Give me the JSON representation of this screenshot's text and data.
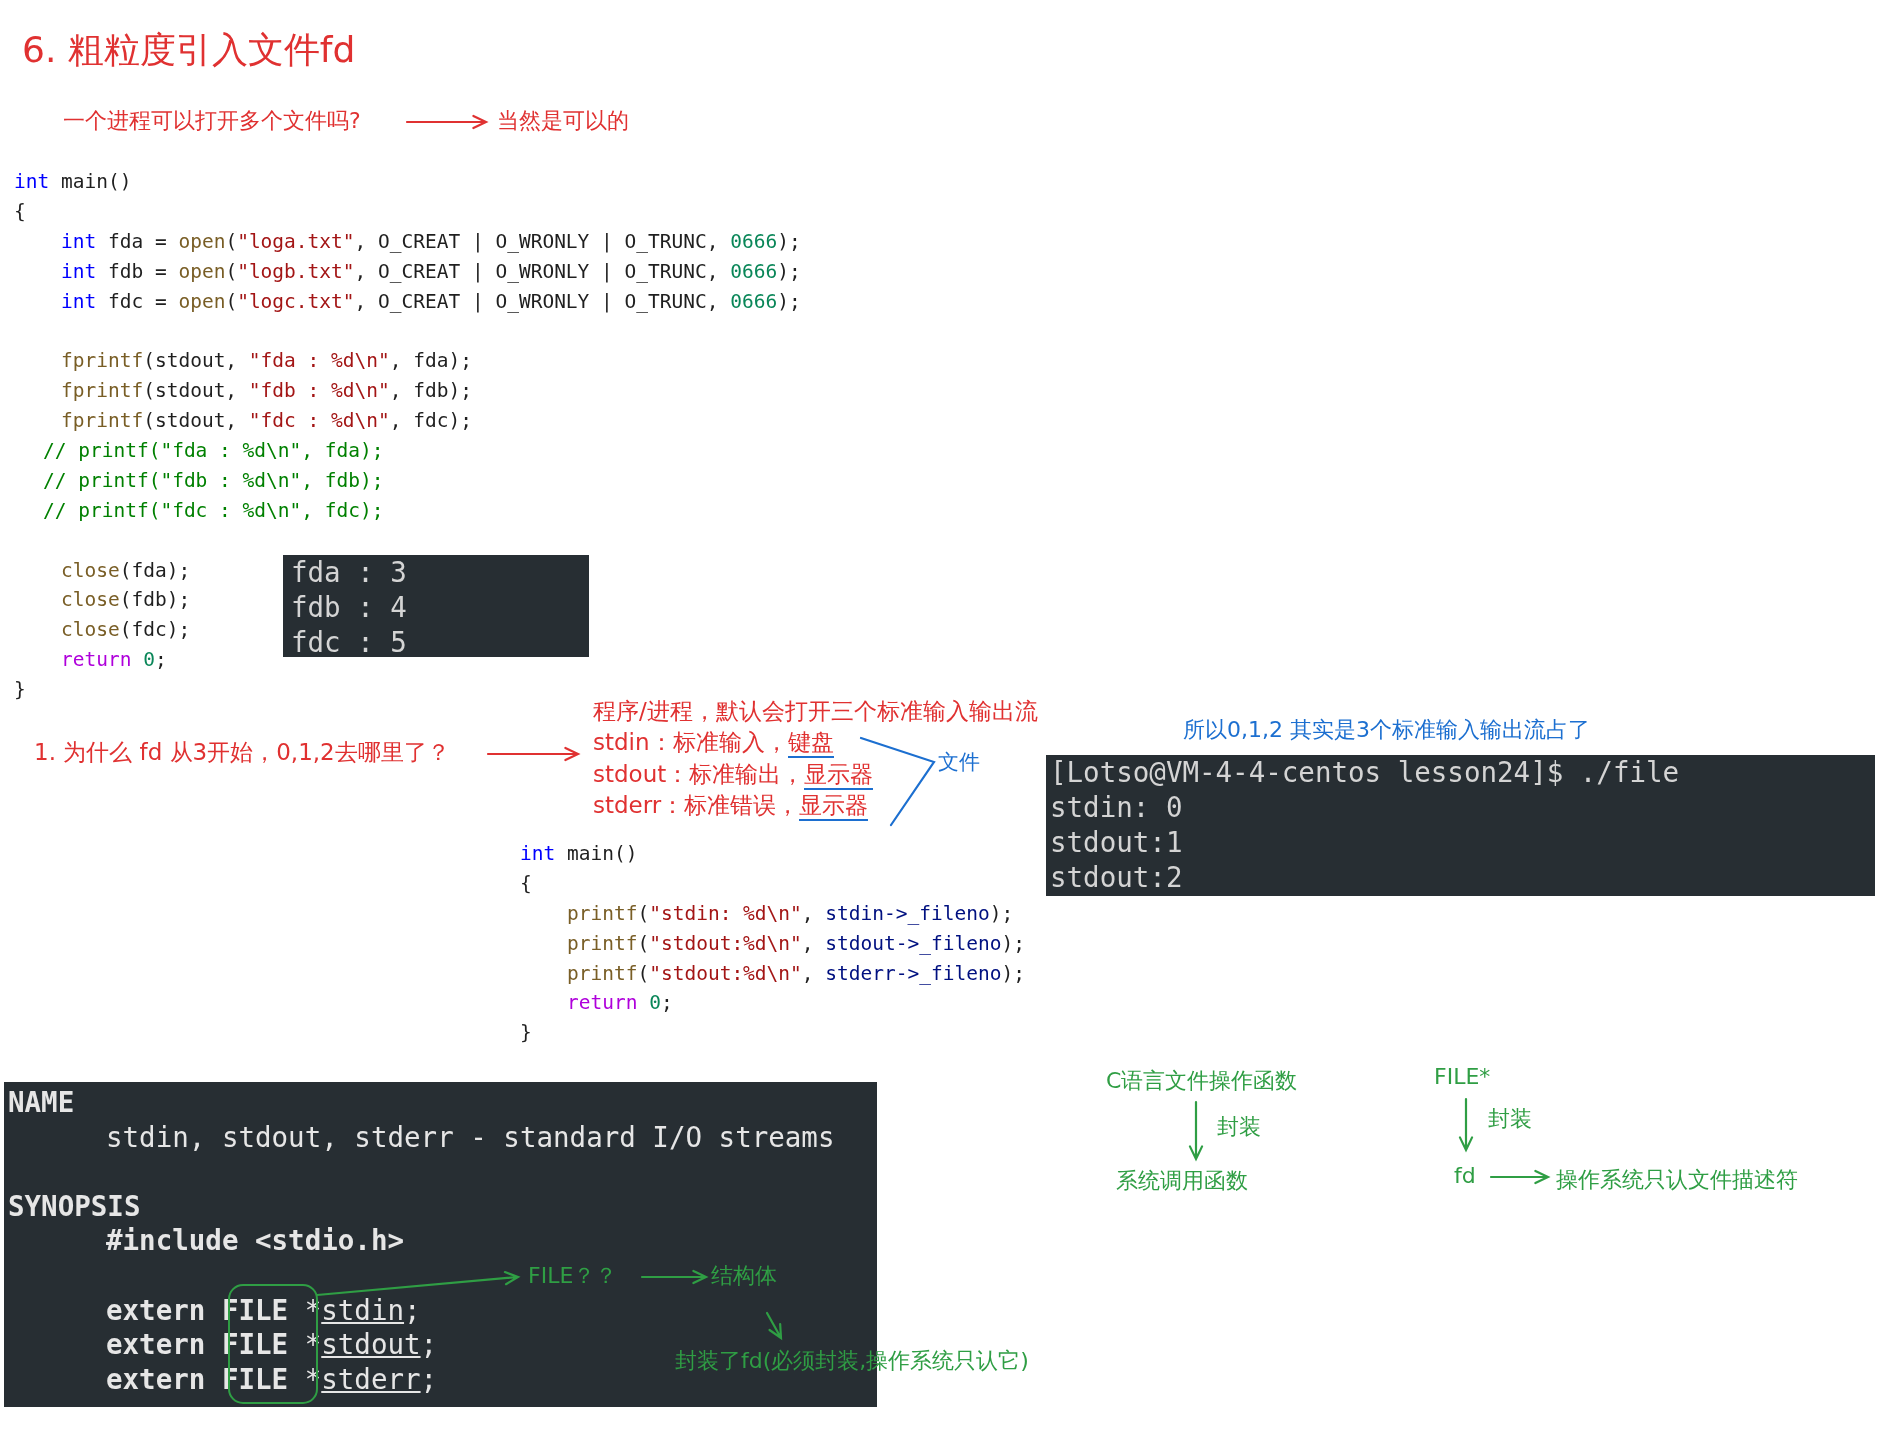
{
  "title": "6. 粗粒度引入文件fd",
  "question": {
    "text": "一个进程可以打开多个文件吗?",
    "answer": "当然是可以的"
  },
  "code_listing_1": {
    "lines": [
      {
        "tokens": [
          {
            "kind": "keyword",
            "text": "int"
          },
          {
            "kind": "plain",
            "text": " main()"
          }
        ]
      },
      {
        "tokens": [
          {
            "kind": "plain",
            "text": "{"
          }
        ]
      },
      {
        "indented": true,
        "tokens": [
          {
            "kind": "keyword",
            "text": "int"
          },
          {
            "kind": "plain",
            "text": " fda = "
          },
          {
            "kind": "function",
            "text": "open"
          },
          {
            "kind": "plain",
            "text": "("
          },
          {
            "kind": "string",
            "text": "\"loga.txt\""
          },
          {
            "kind": "plain",
            "text": ", O_CREAT | O_WRONLY | O_TRUNC, "
          },
          {
            "kind": "number",
            "text": "0666"
          },
          {
            "kind": "plain",
            "text": ");"
          }
        ]
      },
      {
        "indented": true,
        "tokens": [
          {
            "kind": "keyword",
            "text": "int"
          },
          {
            "kind": "plain",
            "text": " fdb = "
          },
          {
            "kind": "function",
            "text": "open"
          },
          {
            "kind": "plain",
            "text": "("
          },
          {
            "kind": "string",
            "text": "\"logb.txt\""
          },
          {
            "kind": "plain",
            "text": ", O_CREAT | O_WRONLY | O_TRUNC, "
          },
          {
            "kind": "number",
            "text": "0666"
          },
          {
            "kind": "plain",
            "text": ");"
          }
        ]
      },
      {
        "indented": true,
        "tokens": [
          {
            "kind": "keyword",
            "text": "int"
          },
          {
            "kind": "plain",
            "text": " fdc = "
          },
          {
            "kind": "function",
            "text": "open"
          },
          {
            "kind": "plain",
            "text": "("
          },
          {
            "kind": "string",
            "text": "\"logc.txt\""
          },
          {
            "kind": "plain",
            "text": ", O_CREAT | O_WRONLY | O_TRUNC, "
          },
          {
            "kind": "number",
            "text": "0666"
          },
          {
            "kind": "plain",
            "text": ");"
          }
        ]
      },
      {
        "indented": true,
        "space_before": true,
        "tokens": [
          {
            "kind": "function",
            "text": "fprintf"
          },
          {
            "kind": "plain",
            "text": "(stdout, "
          },
          {
            "kind": "string",
            "text": "\"fda : %d\\n\""
          },
          {
            "kind": "plain",
            "text": ", fda);"
          }
        ]
      },
      {
        "indented": true,
        "tokens": [
          {
            "kind": "function",
            "text": "fprintf"
          },
          {
            "kind": "plain",
            "text": "(stdout, "
          },
          {
            "kind": "string",
            "text": "\"fdb : %d\\n\""
          },
          {
            "kind": "plain",
            "text": ", fdb);"
          }
        ]
      },
      {
        "indented": true,
        "tokens": [
          {
            "kind": "function",
            "text": "fprintf"
          },
          {
            "kind": "plain",
            "text": "(stdout, "
          },
          {
            "kind": "string",
            "text": "\"fdc : %d\\n\""
          },
          {
            "kind": "plain",
            "text": ", fdc);"
          }
        ]
      },
      {
        "tokens": [
          {
            "kind": "comment",
            "text": "// printf(\"fda : %d\\n\", fda);"
          }
        ]
      },
      {
        "tokens": [
          {
            "kind": "comment",
            "text": "// printf(\"fdb : %d\\n\", fdb);"
          }
        ]
      },
      {
        "tokens": [
          {
            "kind": "comment",
            "text": "// printf(\"fdc : %d\\n\", fdc);"
          }
        ]
      },
      {
        "indented": true,
        "space_before": true,
        "tokens": [
          {
            "kind": "function",
            "text": "close"
          },
          {
            "kind": "plain",
            "text": "(fda);"
          }
        ]
      },
      {
        "indented": true,
        "tokens": [
          {
            "kind": "function",
            "text": "close"
          },
          {
            "kind": "plain",
            "text": "(fdb);"
          }
        ]
      },
      {
        "indented": true,
        "tokens": [
          {
            "kind": "function",
            "text": "close"
          },
          {
            "kind": "plain",
            "text": "(fdc);"
          }
        ]
      },
      {
        "indented": true,
        "tokens": [
          {
            "kind": "control",
            "text": "return"
          },
          {
            "kind": "number",
            "text": "0"
          },
          {
            "kind": "plain",
            "text": ";"
          }
        ]
      },
      {
        "tokens": [
          {
            "kind": "plain",
            "text": "}"
          }
        ]
      }
    ]
  },
  "output_1": {
    "lines": [
      "fda : 3",
      "fdb : 4",
      "fdc : 5"
    ]
  },
  "why_note": "1. 为什么 fd 从3开始，0,1,2去哪里了？",
  "streams_note": {
    "heading": "程序/进程，默认会打开三个标准输入输出流",
    "items": [
      {
        "label": "stdin：标准输入，",
        "device": "键盘"
      },
      {
        "label": "stdout：标准输出，",
        "device": "显示器"
      },
      {
        "label": "stderr：标准错误，",
        "device": "显示器"
      }
    ],
    "bracket_label": "文件"
  },
  "explanation": "所以0,1,2 其实是3个标准输入输出流占了",
  "terminal": {
    "lines": [
      "[Lotso@VM-4-4-centos lesson24]$ ./file",
      "stdin: 0",
      "stdout:1",
      "stdout:2"
    ]
  },
  "code_listing_2": {
    "lines": [
      {
        "tokens": [
          {
            "kind": "keyword",
            "text": "int"
          },
          {
            "kind": "plain",
            "text": " main()"
          }
        ]
      },
      {
        "tokens": [
          {
            "kind": "plain",
            "text": "{"
          }
        ]
      },
      {
        "indented": true,
        "tokens": [
          {
            "kind": "function",
            "text": "printf"
          },
          {
            "kind": "plain",
            "text": "("
          },
          {
            "kind": "string",
            "text": "\"stdin: %d\\n\""
          },
          {
            "kind": "plain",
            "text": ", "
          },
          {
            "kind": "variable",
            "text": "stdin->_fileno"
          },
          {
            "kind": "plain",
            "text": ");"
          }
        ]
      },
      {
        "indented": true,
        "tokens": [
          {
            "kind": "function",
            "text": "printf"
          },
          {
            "kind": "plain",
            "text": "("
          },
          {
            "kind": "string",
            "text": "\"stdout:%d\\n\""
          },
          {
            "kind": "plain",
            "text": ", "
          },
          {
            "kind": "variable",
            "text": "stdout->_fileno"
          },
          {
            "kind": "plain",
            "text": ");"
          }
        ]
      },
      {
        "indented": true,
        "tokens": [
          {
            "kind": "function",
            "text": "printf"
          },
          {
            "kind": "plain",
            "text": "("
          },
          {
            "kind": "string",
            "text": "\"stdout:%d\\n\""
          },
          {
            "kind": "plain",
            "text": ", "
          },
          {
            "kind": "variable",
            "text": "stderr->_fileno"
          },
          {
            "kind": "plain",
            "text": ");"
          }
        ]
      },
      {
        "indented": true,
        "tokens": [
          {
            "kind": "control",
            "text": "return"
          },
          {
            "kind": "number",
            "text": "0"
          },
          {
            "kind": "plain",
            "text": ";"
          }
        ]
      },
      {
        "tokens": [
          {
            "kind": "plain",
            "text": "}"
          }
        ]
      }
    ]
  },
  "man_page": {
    "lines": [
      {
        "tokens": [
          {
            "kind": "bold",
            "text": "NAME"
          }
        ]
      },
      {
        "indented": true,
        "tokens": [
          {
            "kind": "plain",
            "text": "stdin, stdout, stderr - standard I/O streams"
          }
        ]
      },
      {
        "space_before": true,
        "tokens": [
          {
            "kind": "bold",
            "text": "SYNOPSIS"
          }
        ]
      },
      {
        "indented": true,
        "tokens": [
          {
            "kind": "bold",
            "text": "#include <stdio.h>"
          }
        ]
      },
      {
        "indented": true,
        "space_before": true,
        "tokens": [
          {
            "kind": "bold",
            "text": "extern FILE"
          },
          {
            "kind": "plain",
            "text": " *"
          },
          {
            "kind": "underline",
            "text": "stdin"
          },
          {
            "kind": "plain",
            "text": ";"
          }
        ]
      },
      {
        "indented": true,
        "tokens": [
          {
            "kind": "bold",
            "text": "extern FILE"
          },
          {
            "kind": "plain",
            "text": " *"
          },
          {
            "kind": "underline",
            "text": "stdout"
          },
          {
            "kind": "plain",
            "text": ";"
          }
        ]
      },
      {
        "indented": true,
        "tokens": [
          {
            "kind": "bold",
            "text": "extern FILE"
          },
          {
            "kind": "plain",
            "text": " *"
          },
          {
            "kind": "underline",
            "text": "stderr"
          },
          {
            "kind": "plain",
            "text": ";"
          }
        ]
      }
    ]
  },
  "file_annotation": {
    "label": "FILE？？",
    "result": "结构体",
    "note": "封装了fd(必须封装,操作系统只认它)"
  },
  "layering": [
    {
      "top": "C语言文件操作函数",
      "relation": "封装",
      "bottom": "系统调用函数"
    },
    {
      "top": "FILE*",
      "relation": "封装",
      "bottom": "fd",
      "note": "操作系统只认文件描述符"
    }
  ]
}
